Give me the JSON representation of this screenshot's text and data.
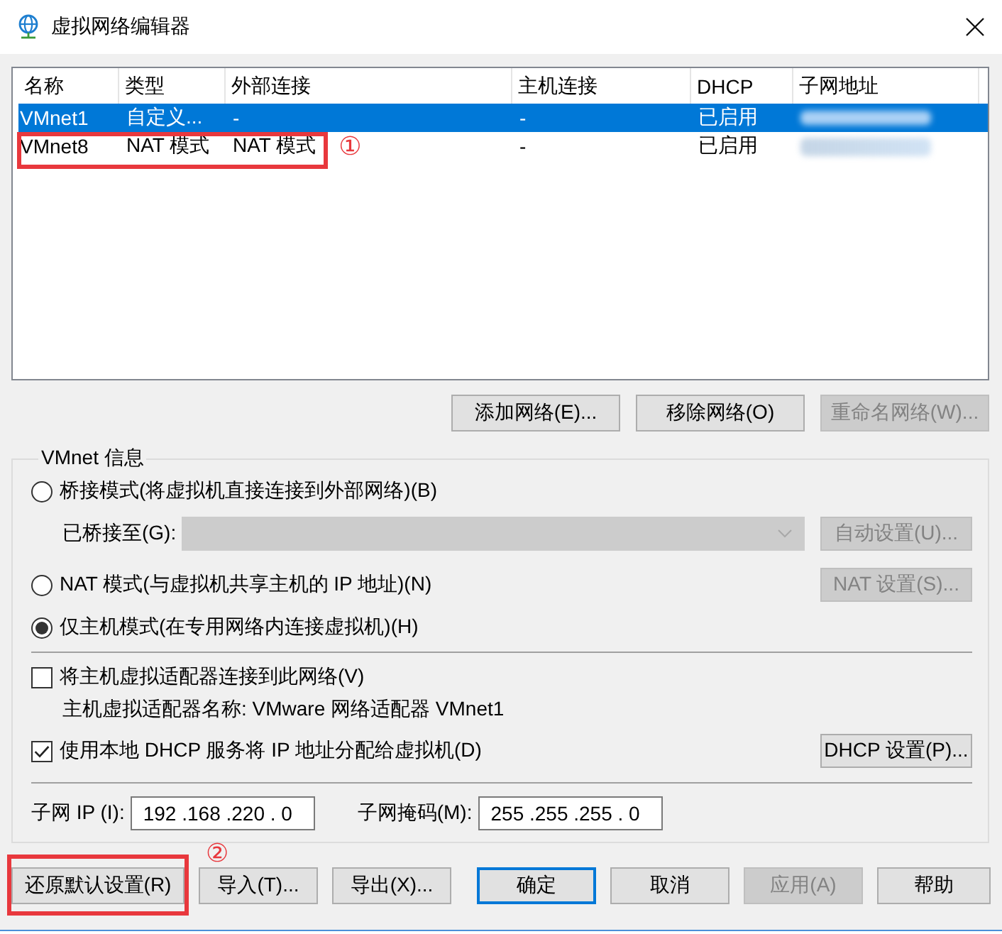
{
  "window": {
    "title": "虚拟网络编辑器"
  },
  "table": {
    "columns": [
      "名称",
      "类型",
      "外部连接",
      "主机连接",
      "DHCP",
      "子网地址"
    ],
    "rows": [
      {
        "name": "VMnet1",
        "type": "自定义...",
        "external": "-",
        "host": "-",
        "dhcp": "已启用",
        "subnet_blurred": true,
        "selected": true,
        "highlighted": false
      },
      {
        "name": "VMnet8",
        "type": "NAT 模式",
        "external": "NAT 模式",
        "host": "-",
        "dhcp": "已启用",
        "subnet_blurred": true,
        "selected": false,
        "highlighted": true,
        "annotation": "①"
      }
    ]
  },
  "network_buttons": [
    {
      "label": "添加网络(E)...",
      "disabled": false
    },
    {
      "label": "移除网络(O)",
      "disabled": false
    },
    {
      "label": "重命名网络(W)...",
      "disabled": true
    }
  ],
  "vmnet_info": {
    "title": "VMnet 信息",
    "modes": [
      {
        "label": "桥接模式(将虚拟机直接连接到外部网络)(B)",
        "selected": false,
        "bridged_to": {
          "label": "已桥接至(G):",
          "disabled": true,
          "button": {
            "label": "自动设置(U)...",
            "disabled": true
          }
        }
      },
      {
        "label": "NAT 模式(与虚拟机共享主机的 IP 地址)(N)",
        "selected": false,
        "settings_button": {
          "label": "NAT 设置(S)...",
          "disabled": true
        }
      },
      {
        "label": "仅主机模式(在专用网络内连接虚拟机)(H)",
        "selected": true
      }
    ],
    "connect_adapter": {
      "label": "将主机虚拟适配器连接到此网络(V)",
      "checked": false
    },
    "adapter_name": "主机虚拟适配器名称: VMware 网络适配器 VMnet1",
    "use_dhcp": {
      "label": "使用本地 DHCP 服务将 IP 地址分配给虚拟机(D)",
      "checked": true,
      "button": {
        "label": "DHCP 设置(P)...",
        "disabled": false
      }
    },
    "subnet_ip": {
      "label": "子网 IP (I):",
      "value": "192 .168 .220 . 0"
    },
    "subnet_mask": {
      "label": "子网掩码(M):",
      "value": "255 .255 .255 . 0"
    }
  },
  "footer_buttons": [
    {
      "label": "还原默认设置(R)",
      "disabled": false,
      "default": false,
      "highlighted": true,
      "annotation": "②"
    },
    {
      "label": "导入(T)...",
      "disabled": false,
      "default": false,
      "highlighted": false
    },
    {
      "label": "导出(X)...",
      "disabled": false,
      "default": false,
      "highlighted": false
    },
    {
      "label": "确定",
      "disabled": false,
      "default": true,
      "highlighted": false
    },
    {
      "label": "取消",
      "disabled": false,
      "default": false,
      "highlighted": false
    },
    {
      "label": "应用(A)",
      "disabled": true,
      "default": false,
      "highlighted": false
    },
    {
      "label": "帮助",
      "disabled": false,
      "default": false,
      "highlighted": false
    }
  ]
}
